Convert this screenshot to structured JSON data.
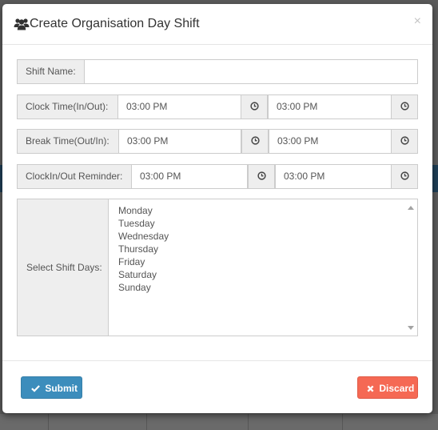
{
  "modal": {
    "title": "Create Organisation Day Shift",
    "title_icon": "users-icon",
    "close_label": "×"
  },
  "form": {
    "shift_name": {
      "label": "Shift Name:",
      "value": ""
    },
    "clock_time": {
      "label": "Clock Time(In/Out):",
      "in_value": "03:00 PM",
      "out_value": "03:00 PM"
    },
    "break_time": {
      "label": "Break Time(Out/In):",
      "out_value": "03:00 PM",
      "in_value": "03:00 PM"
    },
    "reminder": {
      "label": "ClockIn/Out Reminder:",
      "in_value": "03:00 PM",
      "out_value": "03:00 PM"
    },
    "shift_days": {
      "label": "Select Shift Days:",
      "options": [
        "Monday",
        "Tuesday",
        "Wednesday",
        "Thursday",
        "Friday",
        "Saturday",
        "Sunday"
      ]
    }
  },
  "footer": {
    "submit_label": "Submit",
    "discard_label": "Discard"
  },
  "colors": {
    "submit": "#3c8dbc",
    "discard": "#f56954"
  }
}
